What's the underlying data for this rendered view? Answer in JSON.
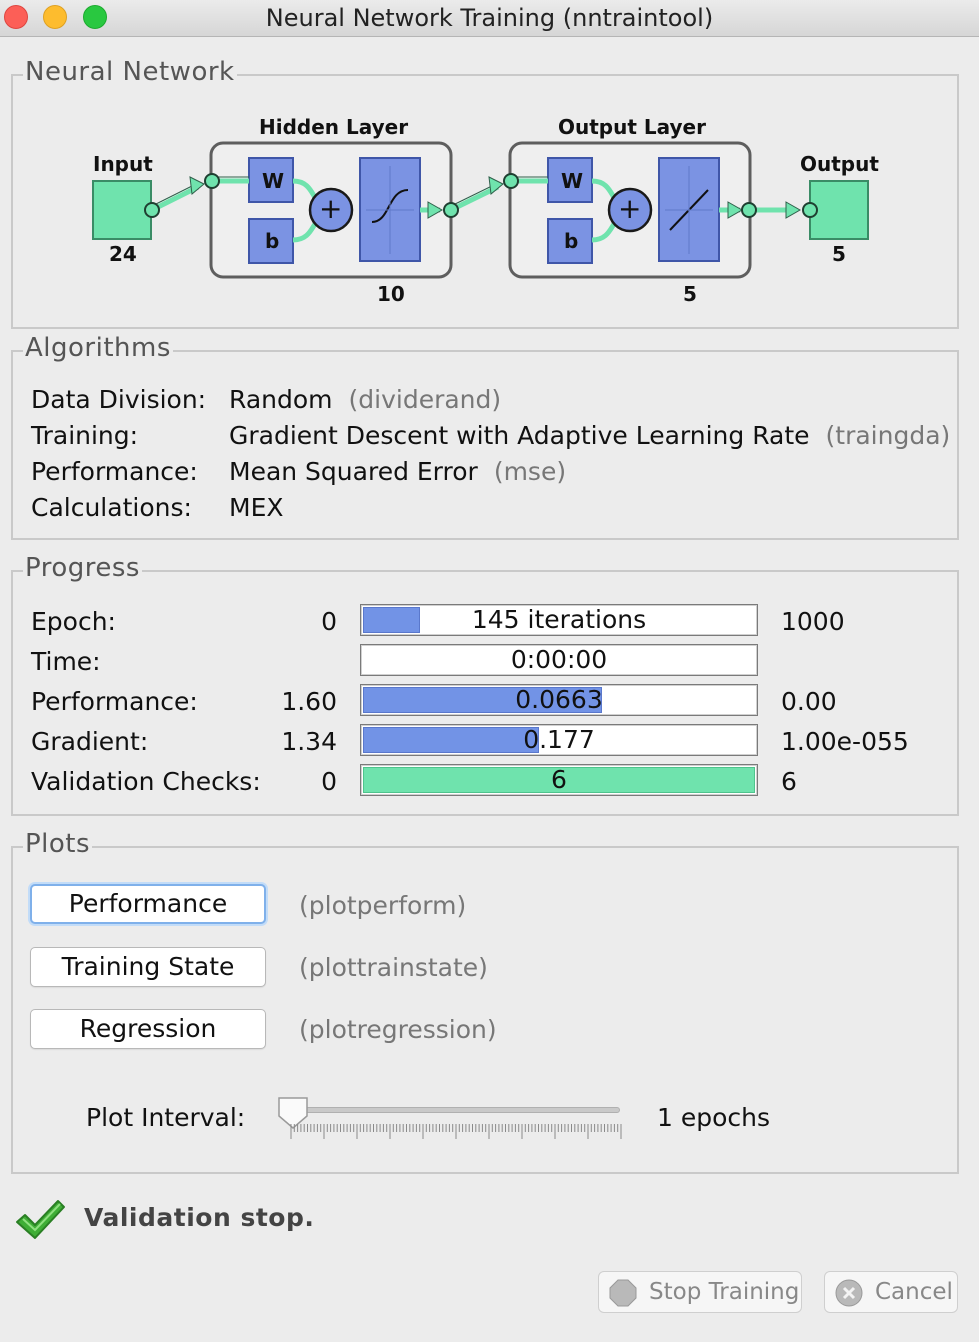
{
  "window": {
    "title": "Neural Network Training (nntraintool)"
  },
  "network": {
    "legend": "Neural Network",
    "input_label": "Input",
    "input_size": "24",
    "hidden_label": "Hidden Layer",
    "hidden_size": "10",
    "output_layer_label": "Output Layer",
    "output_layer_size": "5",
    "output_label": "Output",
    "output_size": "5",
    "w_symbol": "W",
    "b_symbol": "b",
    "plus_symbol": "+"
  },
  "algorithms": {
    "legend": "Algorithms",
    "rows": [
      {
        "label": "Data Division:",
        "value": "Random",
        "fn": "(dividerand)"
      },
      {
        "label": "Training:",
        "value": "Gradient Descent with Adaptive Learning Rate",
        "fn": "(traingda)"
      },
      {
        "label": "Performance:",
        "value": "Mean Squared Error",
        "fn": "(mse)"
      },
      {
        "label": "Calculations:",
        "value": "MEX",
        "fn": ""
      }
    ]
  },
  "progress": {
    "legend": "Progress",
    "rows": [
      {
        "label": "Epoch:",
        "start": "0",
        "bar_text": "145 iterations",
        "end": "1000",
        "fill": 0.145,
        "color": "#7293e6"
      },
      {
        "label": "Time:",
        "start": "",
        "bar_text": "0:00:00",
        "end": "",
        "fill": 0.0,
        "color": "#7293e6"
      },
      {
        "label": "Performance:",
        "start": "1.60",
        "bar_text": "0.0663",
        "end": "0.00",
        "fill": 0.61,
        "color": "#7293e6"
      },
      {
        "label": "Gradient:",
        "start": "1.34",
        "bar_text": "0.177",
        "end": "1.00e-055",
        "fill": 0.45,
        "color": "#7293e6"
      },
      {
        "label": "Validation Checks:",
        "start": "0",
        "bar_text": "6",
        "end": "6",
        "fill": 1.0,
        "color": "#6fe3ad"
      }
    ]
  },
  "plots": {
    "legend": "Plots",
    "buttons": [
      {
        "label": "Performance",
        "fn": "(plotperform)"
      },
      {
        "label": "Training State",
        "fn": "(plottrainstate)"
      },
      {
        "label": "Regression",
        "fn": "(plotregression)"
      }
    ],
    "interval_label": "Plot Interval:",
    "interval_value": "1 epochs"
  },
  "status": {
    "text": "Validation stop."
  },
  "footer": {
    "stop_label": "Stop Training",
    "cancel_label": "Cancel"
  },
  "colors": {
    "layer_blue": "#7b93e3",
    "node_green": "#6fe3ad",
    "check_green": "#3fae36"
  }
}
